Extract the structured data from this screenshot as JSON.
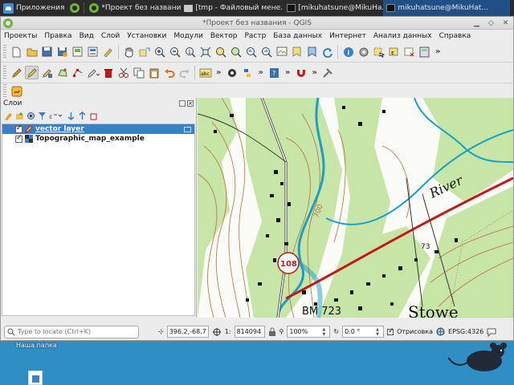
{
  "taskbar": {
    "start_label": "Приложения",
    "tasks": [
      {
        "label": "*Проект без названия...",
        "icon": "qgis-icon"
      },
      {
        "label": "[tmp - Файловый мене...",
        "icon": "folder-icon"
      },
      {
        "label": "[mikuhatsune@MikuHa...",
        "icon": "terminal-icon"
      },
      {
        "label": "mikuhatsune@MikuHat...",
        "icon": "terminal-icon"
      }
    ]
  },
  "window": {
    "title": "*Проект без названия - QGIS",
    "menu": [
      "Проекты",
      "Правка",
      "Вид",
      "Слой",
      "Установки",
      "Модули",
      "Вектор",
      "Растр",
      "База данных",
      "Интернет",
      "Анализ данных",
      "Справка"
    ]
  },
  "layers_panel": {
    "title": "Слои",
    "layers": [
      {
        "name": "vector layer",
        "checked": true,
        "selected": true
      },
      {
        "name": "Topographic_map_example",
        "checked": true,
        "selected": false
      }
    ]
  },
  "map_labels": {
    "route_number": "108",
    "benchmark": "BM 723",
    "town": "Stowe",
    "river": "River",
    "contour_700": "700",
    "elevation_73": "73"
  },
  "statusbar": {
    "locator_placeholder": "Type to locate (Ctrl+K)",
    "coordinate": "396.2,-68.7",
    "scale": "814094",
    "magnifier": "100%",
    "rotation": "0.0 °",
    "render_label": "Отрисовка",
    "crs": "EPSG:4326"
  },
  "desktop": {
    "folder_label": "Наша папка"
  },
  "colors": {
    "selection": "#3a80c8",
    "map_green": "#c8e5a8",
    "water": "#17a0c8",
    "road_red": "#c41818",
    "contour": "#b8703a"
  }
}
